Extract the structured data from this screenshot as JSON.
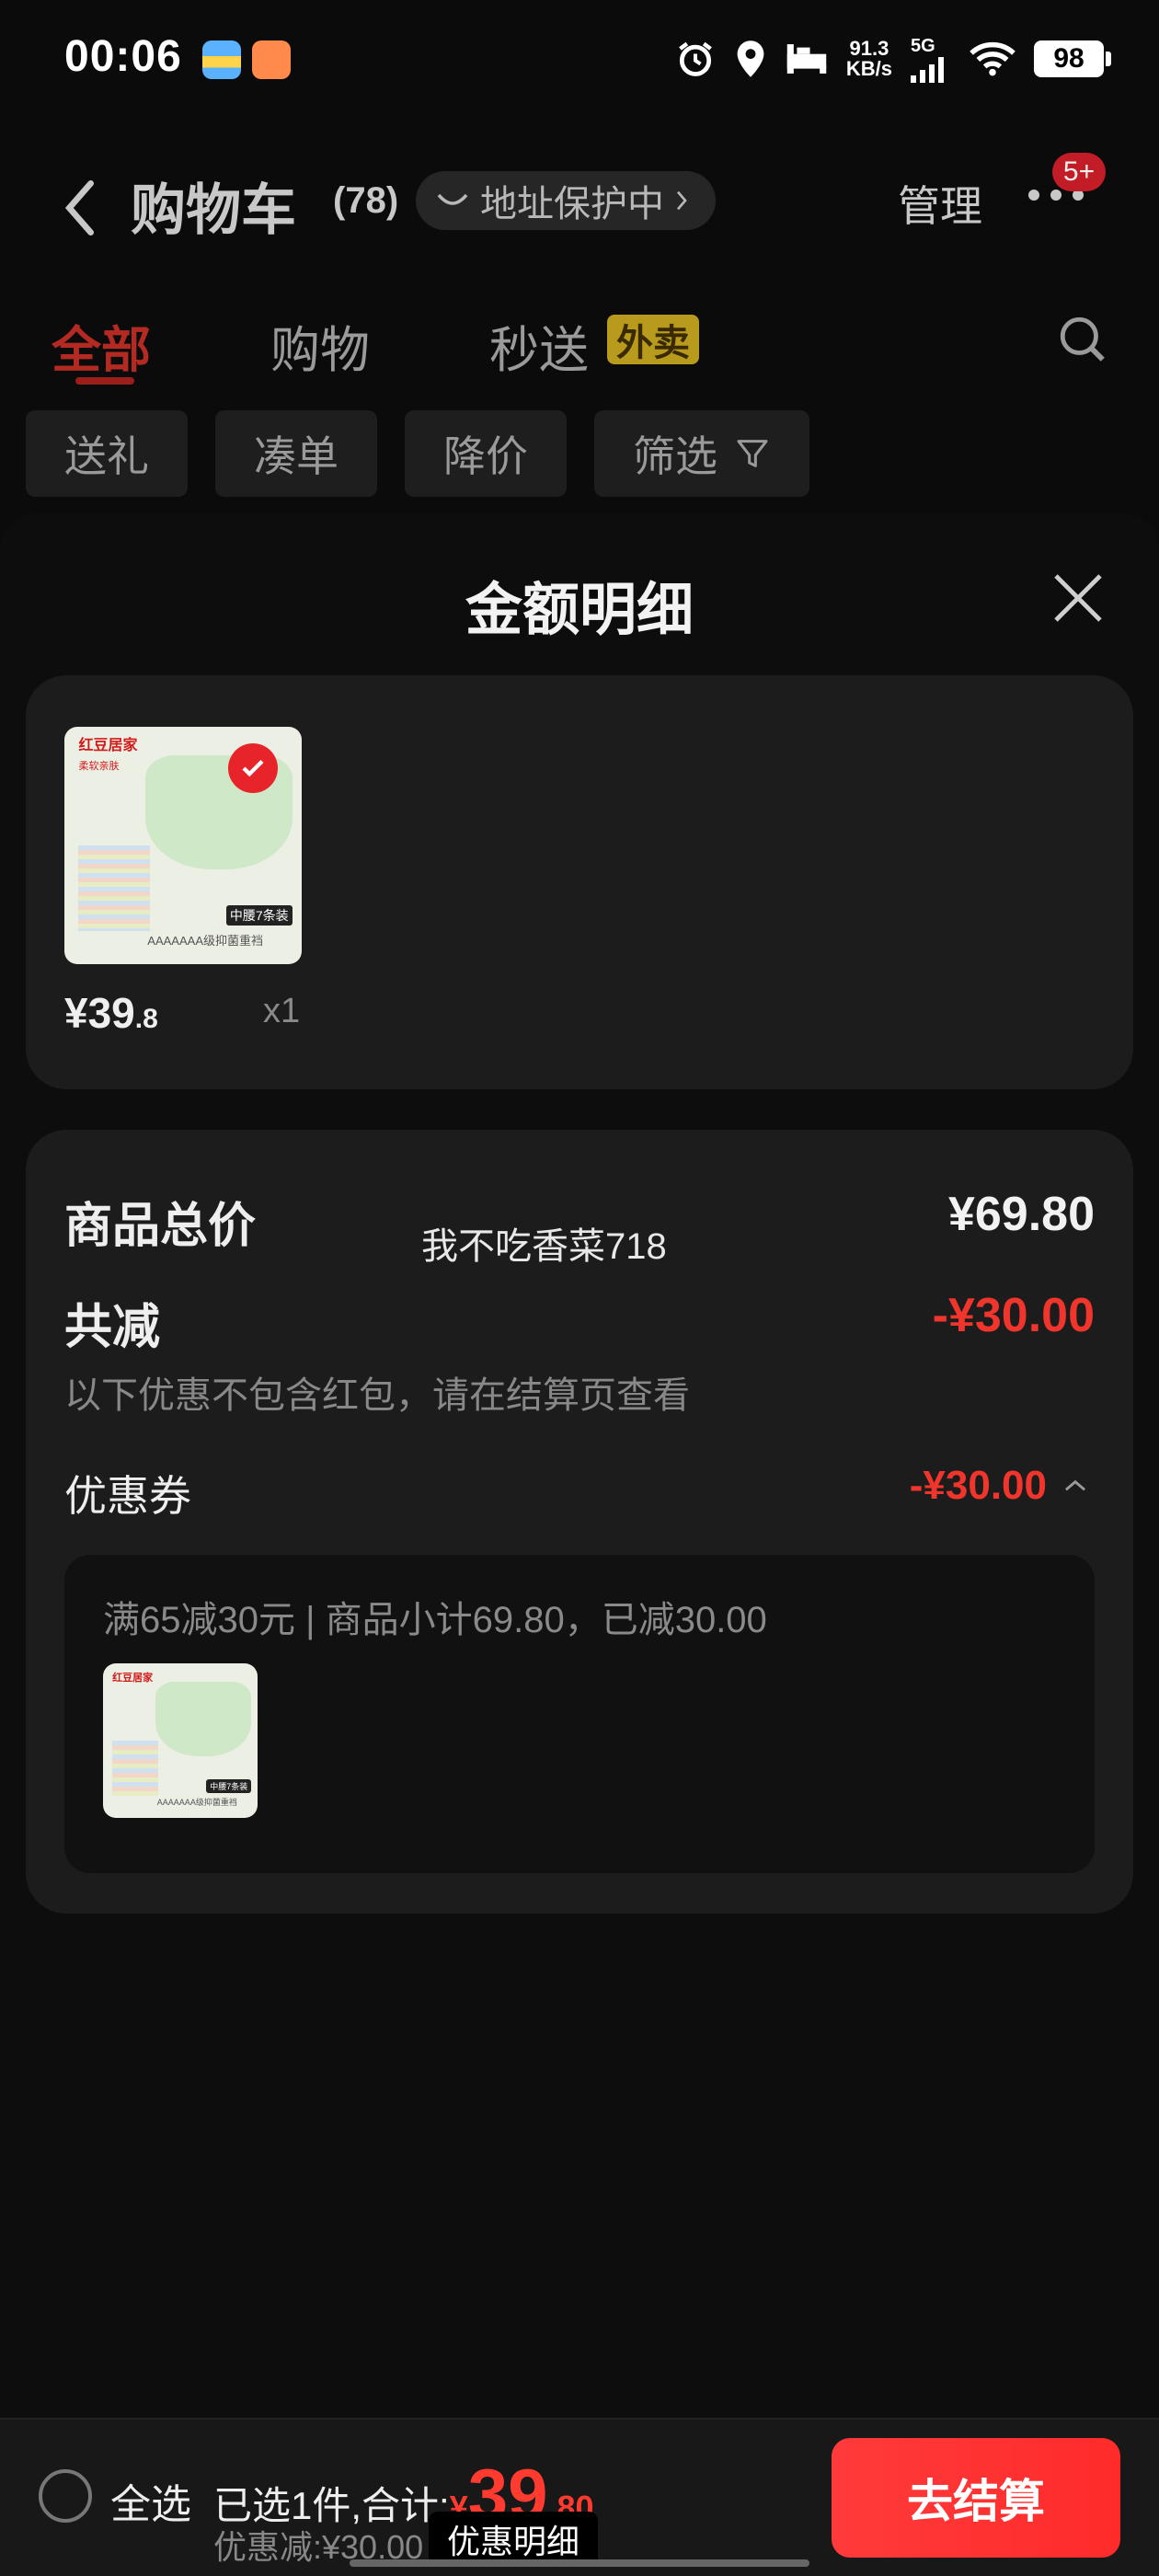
{
  "status_bar": {
    "time": "00:06",
    "speed_value": "91.3",
    "speed_unit": "KB/s",
    "network": "5G",
    "battery": "98",
    "icons": [
      "alarm-icon",
      "location-icon",
      "sleep-icon",
      "signal-icon",
      "wifi-icon"
    ]
  },
  "header": {
    "title": "购物车",
    "count": "(78)",
    "address_protect": "地址保护中",
    "manage": "管理",
    "more_badge": "5+"
  },
  "tabs": [
    {
      "label": "全部",
      "active": true
    },
    {
      "label": "购物",
      "active": false
    },
    {
      "label": "秒送",
      "active": false,
      "tag": "外卖"
    }
  ],
  "filters": [
    "送礼",
    "凑单",
    "降价",
    "筛选"
  ],
  "sheet": {
    "title": "金额明细",
    "item": {
      "thumb_brand": "红豆居家",
      "thumb_sub": "柔软亲肤",
      "thumb_tag": "中腰7条装",
      "thumb_caption": "AAAAAAA级抑菌重裆",
      "price_int": "¥39",
      "price_dec": ".8",
      "qty": "x1"
    },
    "summary": {
      "total_label": "商品总价",
      "total_value": "¥69.80",
      "discount_label": "共减",
      "discount_value": "-¥30.00",
      "note": "以下优惠不包含红包，请在结算页查看",
      "coupon_label": "优惠券",
      "coupon_value": "-¥30.00",
      "coupon_desc": "满65减30元 | 商品小计69.80，已减30.00",
      "watermark": "我不吃香菜718"
    }
  },
  "bottom_bar": {
    "select_all": "全选",
    "selected_text": "已选1件,合计:",
    "currency": "¥",
    "total_int": "39",
    "total_dec": ".80",
    "discount_text": "优惠减:¥30.00",
    "detail_button": "优惠明细",
    "checkout": "去结算"
  },
  "colors": {
    "accent_red": "#ff3b30",
    "tab_active": "#b32a22",
    "tag_yellow": "#b89a1c"
  }
}
